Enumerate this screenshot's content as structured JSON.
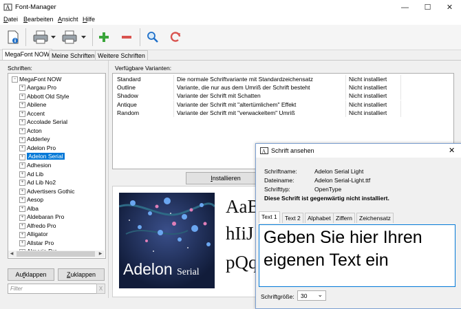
{
  "window": {
    "title": "Font-Manager",
    "min_glyph": "—",
    "max_glyph": "☐",
    "close_glyph": "✕"
  },
  "menu": [
    {
      "first": "D",
      "rest": "atei"
    },
    {
      "first": "B",
      "rest": "earbeiten"
    },
    {
      "first": "A",
      "rest": "nsicht"
    },
    {
      "first": "H",
      "rest": "ilfe"
    }
  ],
  "toolbar": {
    "icons": [
      "document-info-icon",
      "printer-icon",
      "printer-dropdown-icon",
      "printer-alt-icon",
      "printer-alt-dropdown-icon",
      "add-icon",
      "remove-icon",
      "search-icon",
      "refresh-icon"
    ],
    "add_color": "#3aa53a",
    "remove_color": "#d9534f",
    "refresh_color": "#d9534f"
  },
  "tabs": [
    "MegaFont NOW",
    "Meine Schriften",
    "Weitere Schriften"
  ],
  "left": {
    "fonts_label": "Schriften:",
    "root": "MegaFont NOW",
    "root_toggle": "−",
    "node_toggle": "+",
    "items": [
      "Aargau Pro",
      "Abbott Old Style",
      "Abilene",
      "Accent",
      "Accolade Serial",
      "Acton",
      "Adderley",
      "Adelon Pro",
      "Adelon Serial",
      "Adhesion",
      "Ad Lib",
      "Ad Lib No2",
      "Advertisers Gothic",
      "Aesop",
      "Alba",
      "Aldebaran Pro",
      "Alfredo Pro",
      "Alligator",
      "Allstar Pro",
      "Almeria Pro"
    ],
    "selected": "Adelon Serial",
    "collapse_first": "f",
    "collapse_pre": "Au",
    "collapse_post": "klappen",
    "expand_first": "Z",
    "expand_rest": "uklappen",
    "filter_placeholder": "Filter",
    "filter_clear": "X"
  },
  "variants": {
    "label": "Verfügbare Varianten:",
    "rows": [
      {
        "name": "Standard",
        "desc": "Die normale Schriftvariante mit Standardzeichensatz",
        "status": "Nicht installiert"
      },
      {
        "name": "Outline",
        "desc": "Variante, die nur aus dem Umriß der Schrift besteht",
        "status": "Nicht installiert"
      },
      {
        "name": "Shadow",
        "desc": "Variante der Schrift mit Schatten",
        "status": "Nicht installiert"
      },
      {
        "name": "Antique",
        "desc": "Variante der Schrift mit \"altertümlichem\" Effekt",
        "status": "Nicht installiert"
      },
      {
        "name": "Random",
        "desc": "Variante der Schrift mit \"verwackeltem\" Umriß",
        "status": "Nicht installiert"
      }
    ],
    "install_first": "I",
    "install_rest": "nstallieren"
  },
  "preview": {
    "logo_name": "Adelon",
    "logo_suffix": "Serial",
    "line1": "AaB",
    "line2": "hIiJ",
    "line3": "pQq"
  },
  "dialog": {
    "title": "Schrift ansehen",
    "close_glyph": "✕",
    "fields": [
      {
        "label": "Schriftname:",
        "value": "Adelon Serial Light"
      },
      {
        "label": "Dateiname:",
        "value": "Adelon Serial-Light.ttf"
      },
      {
        "label": "Schrifttyp:",
        "value": "OpenType"
      }
    ],
    "notice": "Diese Schrift ist gegenwärtig nicht installiert.",
    "tabs": [
      "Text 1",
      "Text 2",
      "Alphabet",
      "Ziffern",
      "Zeichensatz"
    ],
    "sample_text": "Geben Sie hier Ihren eigenen Text ein",
    "size_label": "Schriftgröße:",
    "size_value": "30",
    "size_arrow": "⌄"
  }
}
